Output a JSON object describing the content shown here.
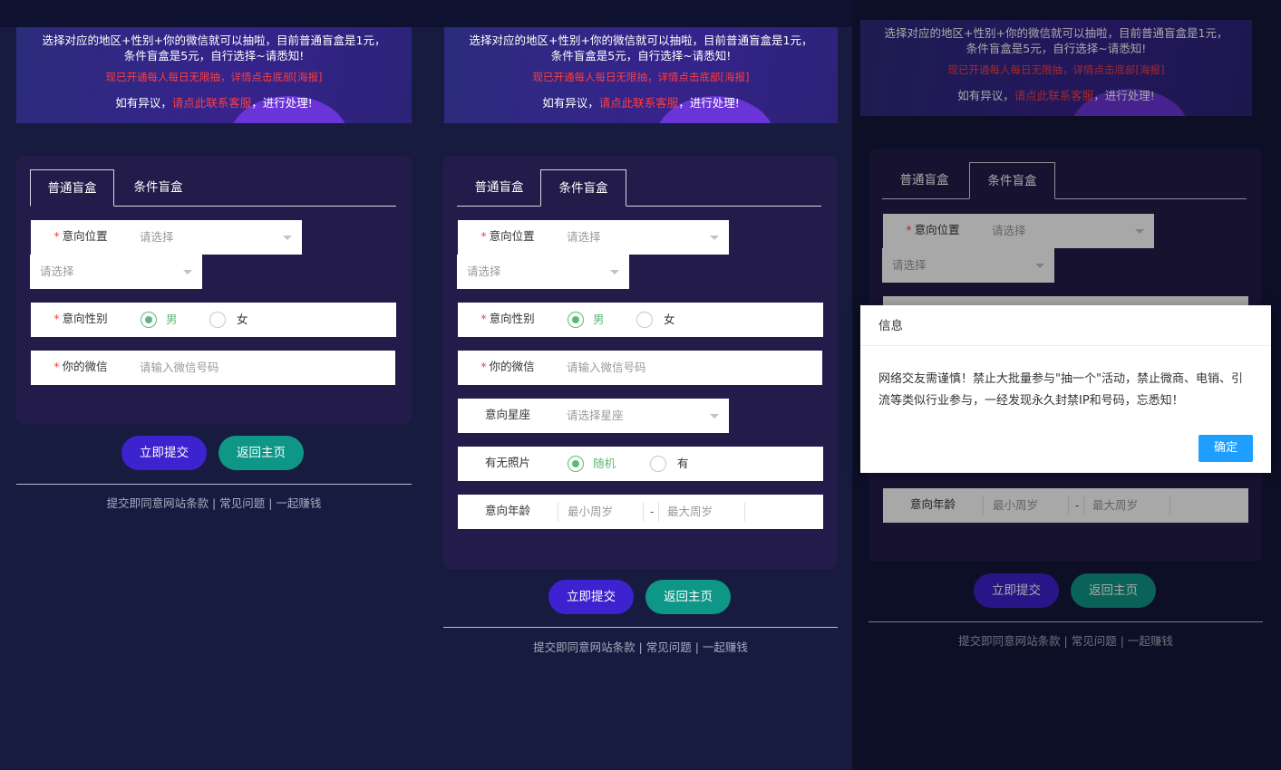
{
  "banner": {
    "line1a": "选择对应的地区+性别+你的微信就可以抽啦，目前普通盲盒是1元，",
    "line1b": "条件盲盒是5元，自行选择~请悉知!",
    "line2": "现已开通每人每日无限抽，详情点击底部[海报]",
    "line3a": "如有异议，",
    "line3b": "请点此联系客服",
    "line3c": "，进行处理!"
  },
  "tabs": {
    "normal": "普通盲盒",
    "conditional": "条件盲盒"
  },
  "form": {
    "location_label": "意向位置",
    "select_placeholder": "请选择",
    "gender_label": "意向性别",
    "male": "男",
    "female": "女",
    "wechat_label": "你的微信",
    "wechat_placeholder": "请输入微信号码",
    "zodiac_label": "意向星座",
    "zodiac_placeholder": "请选择星座",
    "photo_label": "有无照片",
    "photo_random": "随机",
    "photo_yes": "有",
    "age_label": "意向年龄",
    "age_min_placeholder": "最小周岁",
    "age_max_placeholder": "最大周岁",
    "age_sep": "-",
    "required_mark": "*"
  },
  "buttons": {
    "submit": "立即提交",
    "home": "返回主页"
  },
  "footer": {
    "text": "提交即同意网站条款 | 常见问题 | 一起赚钱"
  },
  "dialog": {
    "title": "信息",
    "body": "网络交友需谨慎！禁止大批量参与\"抽一个\"活动，禁止微商、电销、引流等类似行业参与，一经发现永久封禁IP和号码，忘悉知！",
    "confirm": "确定"
  },
  "colors": {
    "accent_red": "#ff3d3d",
    "submit": "#3d22cf",
    "home": "#0e9686",
    "radio_on": "#5fb878",
    "dialog_btn": "#1e9fff"
  }
}
